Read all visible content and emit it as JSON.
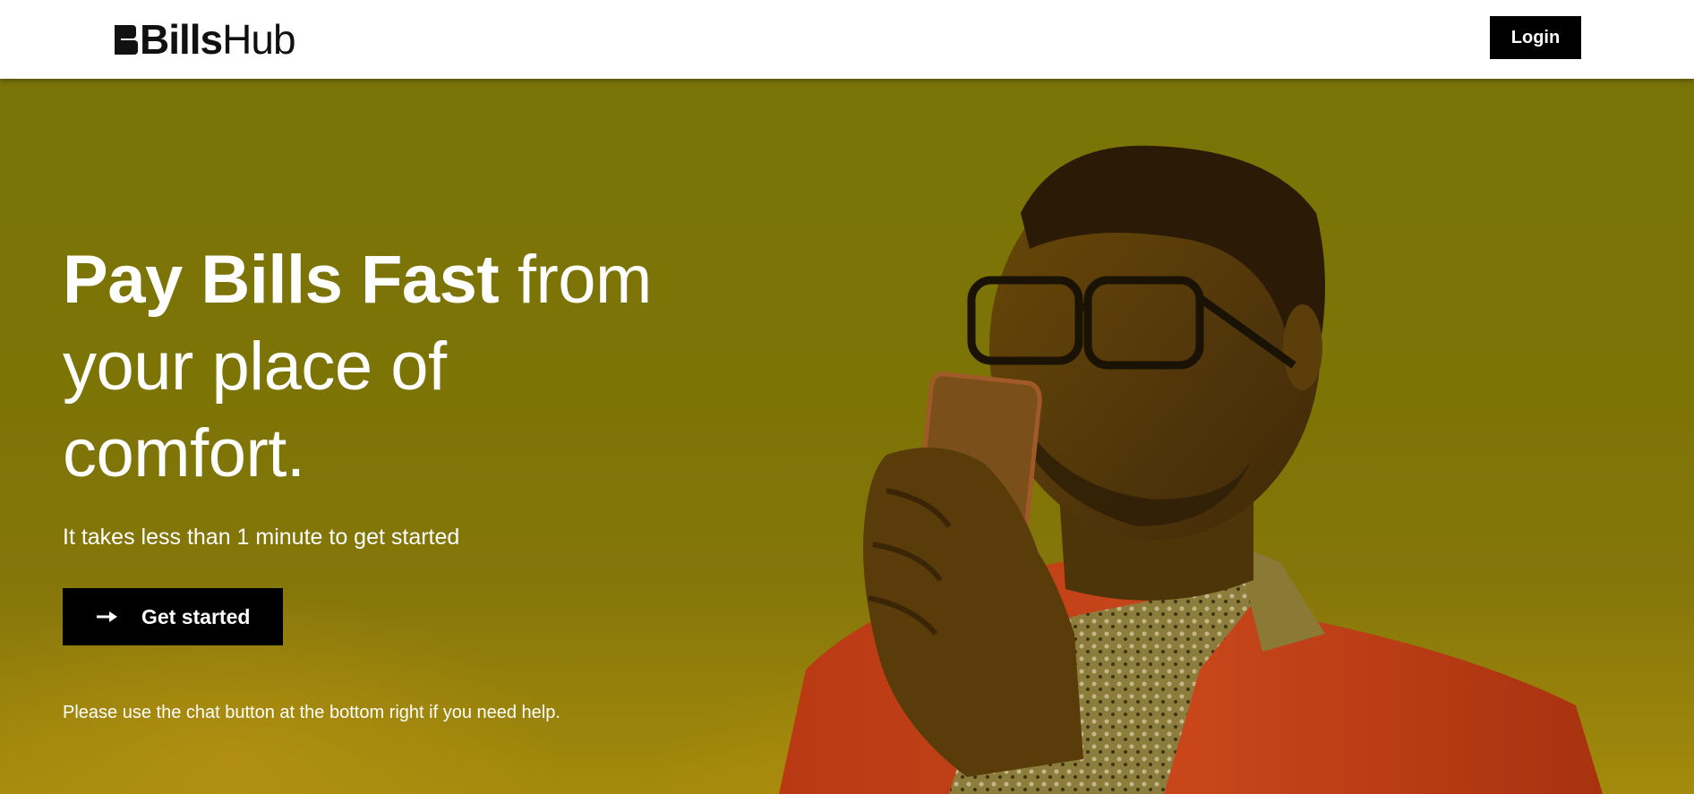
{
  "header": {
    "logo_bold": "Bills",
    "logo_light": "Hub",
    "login_label": "Login"
  },
  "hero": {
    "headline_bold": "Pay Bills Fast",
    "headline_rest": " from your place of comfort.",
    "subtitle": "It takes less than 1 minute to get started",
    "cta_label": "Get started",
    "cta_icon": "arrow-right-icon",
    "help_text": "Please use the chat button at the bottom right if you need help.",
    "image_subject": "man-with-phone"
  },
  "colors": {
    "overlay": "#7d7406",
    "button": "#000000",
    "text_light": "#ffffff",
    "header_bg": "#ffffff"
  }
}
